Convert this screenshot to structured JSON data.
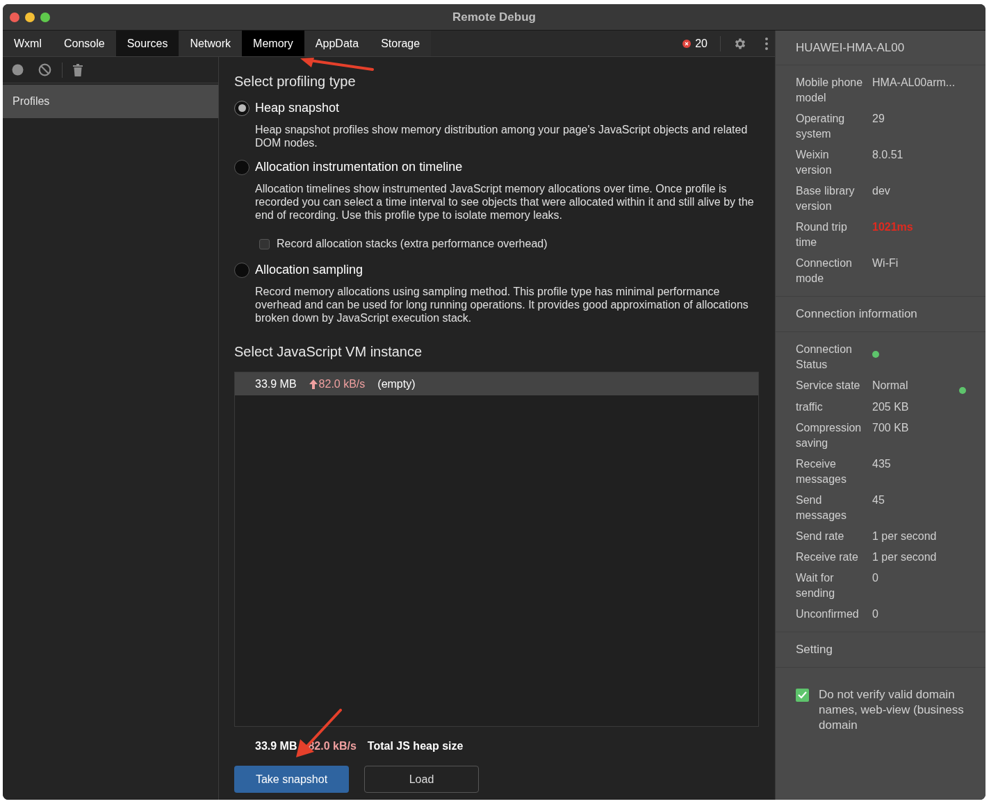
{
  "window": {
    "title": "Remote Debug"
  },
  "tabs": [
    {
      "label": "Wxml",
      "selected": false
    },
    {
      "label": "Console",
      "selected": false
    },
    {
      "label": "Sources",
      "selected": false,
      "highlighted": true
    },
    {
      "label": "Network",
      "selected": false
    },
    {
      "label": "Memory",
      "selected": true
    },
    {
      "label": "AppData",
      "selected": false
    },
    {
      "label": "Storage",
      "selected": false
    }
  ],
  "error_count": "20",
  "sidebar": {
    "items": [
      {
        "label": "Profiles",
        "selected": true
      }
    ]
  },
  "profiling": {
    "heading": "Select profiling type",
    "options": [
      {
        "label": "Heap snapshot",
        "selected": true,
        "description": "Heap snapshot profiles show memory distribution among your page's JavaScript objects and related DOM nodes."
      },
      {
        "label": "Allocation instrumentation on timeline",
        "selected": false,
        "description": "Allocation timelines show instrumented JavaScript memory allocations over time. Once profile is recorded you can select a time interval to see objects that were allocated within it and still alive by the end of recording. Use this profile type to isolate memory leaks.",
        "checkbox": {
          "label": "Record allocation stacks (extra performance overhead)",
          "checked": false
        }
      },
      {
        "label": "Allocation sampling",
        "selected": false,
        "description": "Record memory allocations using sampling method. This profile type has minimal performance overhead and can be used for long running operations. It provides good approximation of allocations broken down by JavaScript execution stack."
      }
    ]
  },
  "vm": {
    "heading": "Select JavaScript VM instance",
    "rows": [
      {
        "size": "33.9 MB",
        "rate": "82.0 kB/s",
        "label": "(empty)",
        "selected": true
      }
    ]
  },
  "footer": {
    "size": "33.9 MB",
    "rate": "82.0 kB/s",
    "label": "Total JS heap size"
  },
  "buttons": [
    {
      "label": "Take snapshot",
      "kind": "primary"
    },
    {
      "label": "Load",
      "kind": "secondary"
    }
  ],
  "device": {
    "title": "HUAWEI-HMA-AL00",
    "rows": [
      {
        "label": "Mobile phone model",
        "value": "HMA-AL00arm...",
        "alert": false
      },
      {
        "label": "Operating system",
        "value": "29",
        "alert": false
      },
      {
        "label": "Weixin version",
        "value": "8.0.51",
        "alert": false
      },
      {
        "label": "Base library version",
        "value": "dev",
        "alert": false
      },
      {
        "label": "Round trip time",
        "value": "1021ms",
        "alert": true
      },
      {
        "label": "Connection mode",
        "value": "Wi-Fi",
        "alert": false
      }
    ]
  },
  "connection": {
    "title": "Connection information",
    "rows": [
      {
        "label": "Connection Status",
        "status_dot": true
      },
      {
        "label": "Service state",
        "value": "Normal",
        "status_dot": true
      },
      {
        "label": "traffic",
        "value": "205 KB"
      },
      {
        "label": "Compression saving",
        "value": "700 KB"
      },
      {
        "label": "Receive messages",
        "value": "435"
      },
      {
        "label": "Send messages",
        "value": "45"
      },
      {
        "label": "Send rate",
        "value": "1 per second"
      },
      {
        "label": "Receive rate",
        "value": "1 per second"
      },
      {
        "label": "Wait for sending",
        "value": "0"
      },
      {
        "label": "Unconfirmed",
        "value": "0"
      }
    ]
  },
  "setting": {
    "title": "Setting",
    "options": [
      {
        "label": "Do not verify valid domain names, web-view (business domain",
        "checked": true
      }
    ]
  }
}
